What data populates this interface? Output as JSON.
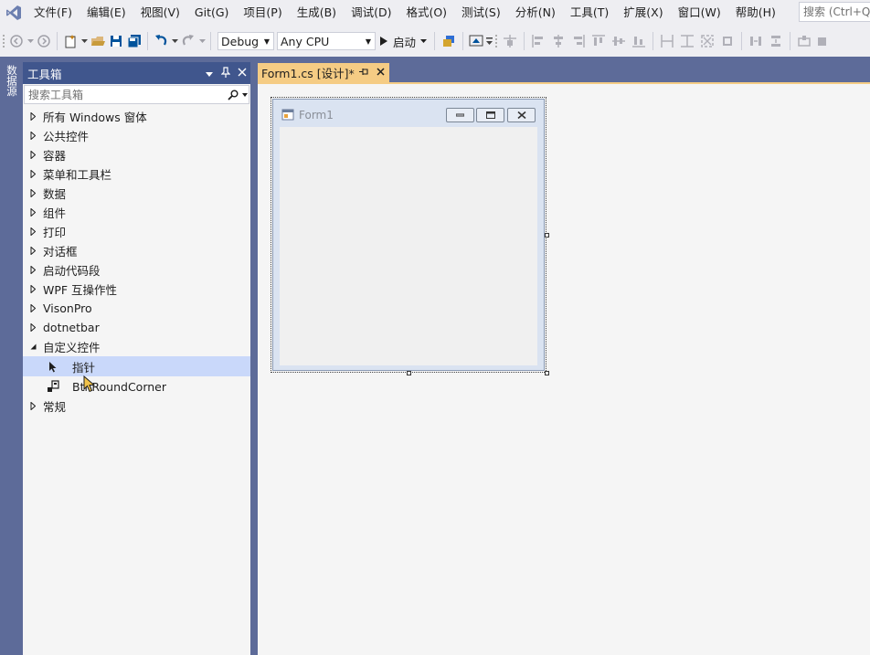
{
  "menu": {
    "items": [
      "文件(F)",
      "编辑(E)",
      "视图(V)",
      "Git(G)",
      "项目(P)",
      "生成(B)",
      "调试(D)",
      "格式(O)",
      "测试(S)",
      "分析(N)",
      "工具(T)",
      "扩展(X)",
      "窗口(W)",
      "帮助(H)"
    ],
    "search_placeholder": "搜索 (Ctrl+Q)"
  },
  "toolbar": {
    "configuration": "Debug",
    "platform": "Any CPU",
    "start_label": "启动"
  },
  "side_strip": {
    "tab_label": "数据源"
  },
  "toolbox": {
    "title": "工具箱",
    "search_placeholder": "搜索工具箱",
    "groups": [
      {
        "label": "所有 Windows 窗体",
        "expanded": false
      },
      {
        "label": "公共控件",
        "expanded": false
      },
      {
        "label": "容器",
        "expanded": false
      },
      {
        "label": "菜单和工具栏",
        "expanded": false
      },
      {
        "label": "数据",
        "expanded": false
      },
      {
        "label": "组件",
        "expanded": false
      },
      {
        "label": "打印",
        "expanded": false
      },
      {
        "label": "对话框",
        "expanded": false
      },
      {
        "label": "启动代码段",
        "expanded": false
      },
      {
        "label": "WPF 互操作性",
        "expanded": false
      },
      {
        "label": "VisonPro",
        "expanded": false
      },
      {
        "label": "dotnetbar",
        "expanded": false
      },
      {
        "label": "自定义控件",
        "expanded": true
      },
      {
        "label": "常规",
        "expanded": false
      }
    ],
    "custom_items": [
      {
        "label": "指针",
        "icon": "pointer-icon",
        "selected": true
      },
      {
        "label": "BtnRoundCorner",
        "icon": "component-icon",
        "selected": false
      }
    ]
  },
  "document": {
    "tab_title": "Form1.cs [设计]*"
  },
  "designer": {
    "form_title": "Form1"
  },
  "colors": {
    "chrome_background": "#eeeef2",
    "frame_blue": "#5d6b99",
    "toolbox_header": "#40568d",
    "active_tab": "#f5cc84",
    "selection": "#c9d8fa",
    "vs_purple": "#68217a"
  }
}
